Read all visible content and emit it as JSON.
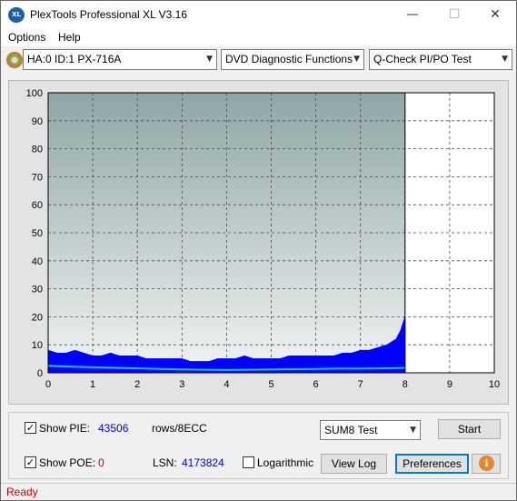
{
  "window": {
    "title": "PlexTools Professional XL V3.16",
    "icon_text": "XL"
  },
  "menu": [
    {
      "label": "Options"
    },
    {
      "label": "Help"
    }
  ],
  "toolbar": {
    "drive": "HA:0 ID:1  PX-716A",
    "function": "DVD Diagnostic Functions",
    "test": "Q-Check PI/PO Test"
  },
  "chart_data": {
    "type": "area",
    "xlim": [
      0,
      10
    ],
    "ylim": [
      0,
      100
    ],
    "x_ticks": [
      "0",
      "1",
      "2",
      "3",
      "4",
      "5",
      "6",
      "7",
      "8",
      "9",
      "10"
    ],
    "y_ticks": [
      "0",
      "10",
      "20",
      "30",
      "40",
      "50",
      "60",
      "70",
      "80",
      "90",
      "100"
    ],
    "grid": true,
    "data_end_x": 8.0,
    "series": [
      {
        "color": "#0000ff",
        "x": [
          0.0,
          0.2,
          0.4,
          0.6,
          0.8,
          1.0,
          1.2,
          1.4,
          1.6,
          1.8,
          2.0,
          2.2,
          2.4,
          2.6,
          2.8,
          3.0,
          3.2,
          3.4,
          3.6,
          3.8,
          4.0,
          4.2,
          4.4,
          4.6,
          4.8,
          5.0,
          5.2,
          5.4,
          5.6,
          5.8,
          6.0,
          6.2,
          6.4,
          6.6,
          6.8,
          7.0,
          7.2,
          7.4,
          7.6,
          7.8,
          7.9,
          8.0
        ],
        "y": [
          8,
          7,
          7,
          8,
          7,
          6,
          6,
          7,
          6,
          6,
          6,
          5,
          5,
          5,
          5,
          5,
          4,
          4,
          4,
          5,
          5,
          5,
          6,
          5,
          5,
          5,
          5,
          6,
          6,
          6,
          6,
          6,
          6,
          7,
          7,
          8,
          8,
          9,
          10,
          12,
          15,
          20
        ]
      },
      {
        "color": "#00d0d0",
        "x": [
          0.0,
          0.5,
          1.0,
          1.5,
          2.0,
          2.5,
          3.0,
          3.5,
          4.0,
          4.5,
          5.0,
          5.5,
          6.0,
          6.5,
          7.0,
          7.5,
          8.0
        ],
        "y": [
          2.5,
          2.2,
          2.0,
          1.8,
          1.6,
          1.4,
          1.2,
          1.1,
          1.0,
          1.1,
          1.2,
          1.3,
          1.4,
          1.5,
          1.5,
          1.6,
          1.8
        ]
      }
    ]
  },
  "bottom": {
    "show_pie_label": "Show PIE:",
    "pie_value": "43506",
    "pie_unit": "rows/8ECC",
    "show_poe_label": "Show POE:",
    "poe_value": "0",
    "lsn_label": "LSN:",
    "lsn_value": "4173824",
    "log_label": "Logarithmic",
    "sum_test": "SUM8 Test",
    "start": "Start",
    "view_log": "View Log",
    "preferences": "Preferences"
  },
  "status": "Ready"
}
